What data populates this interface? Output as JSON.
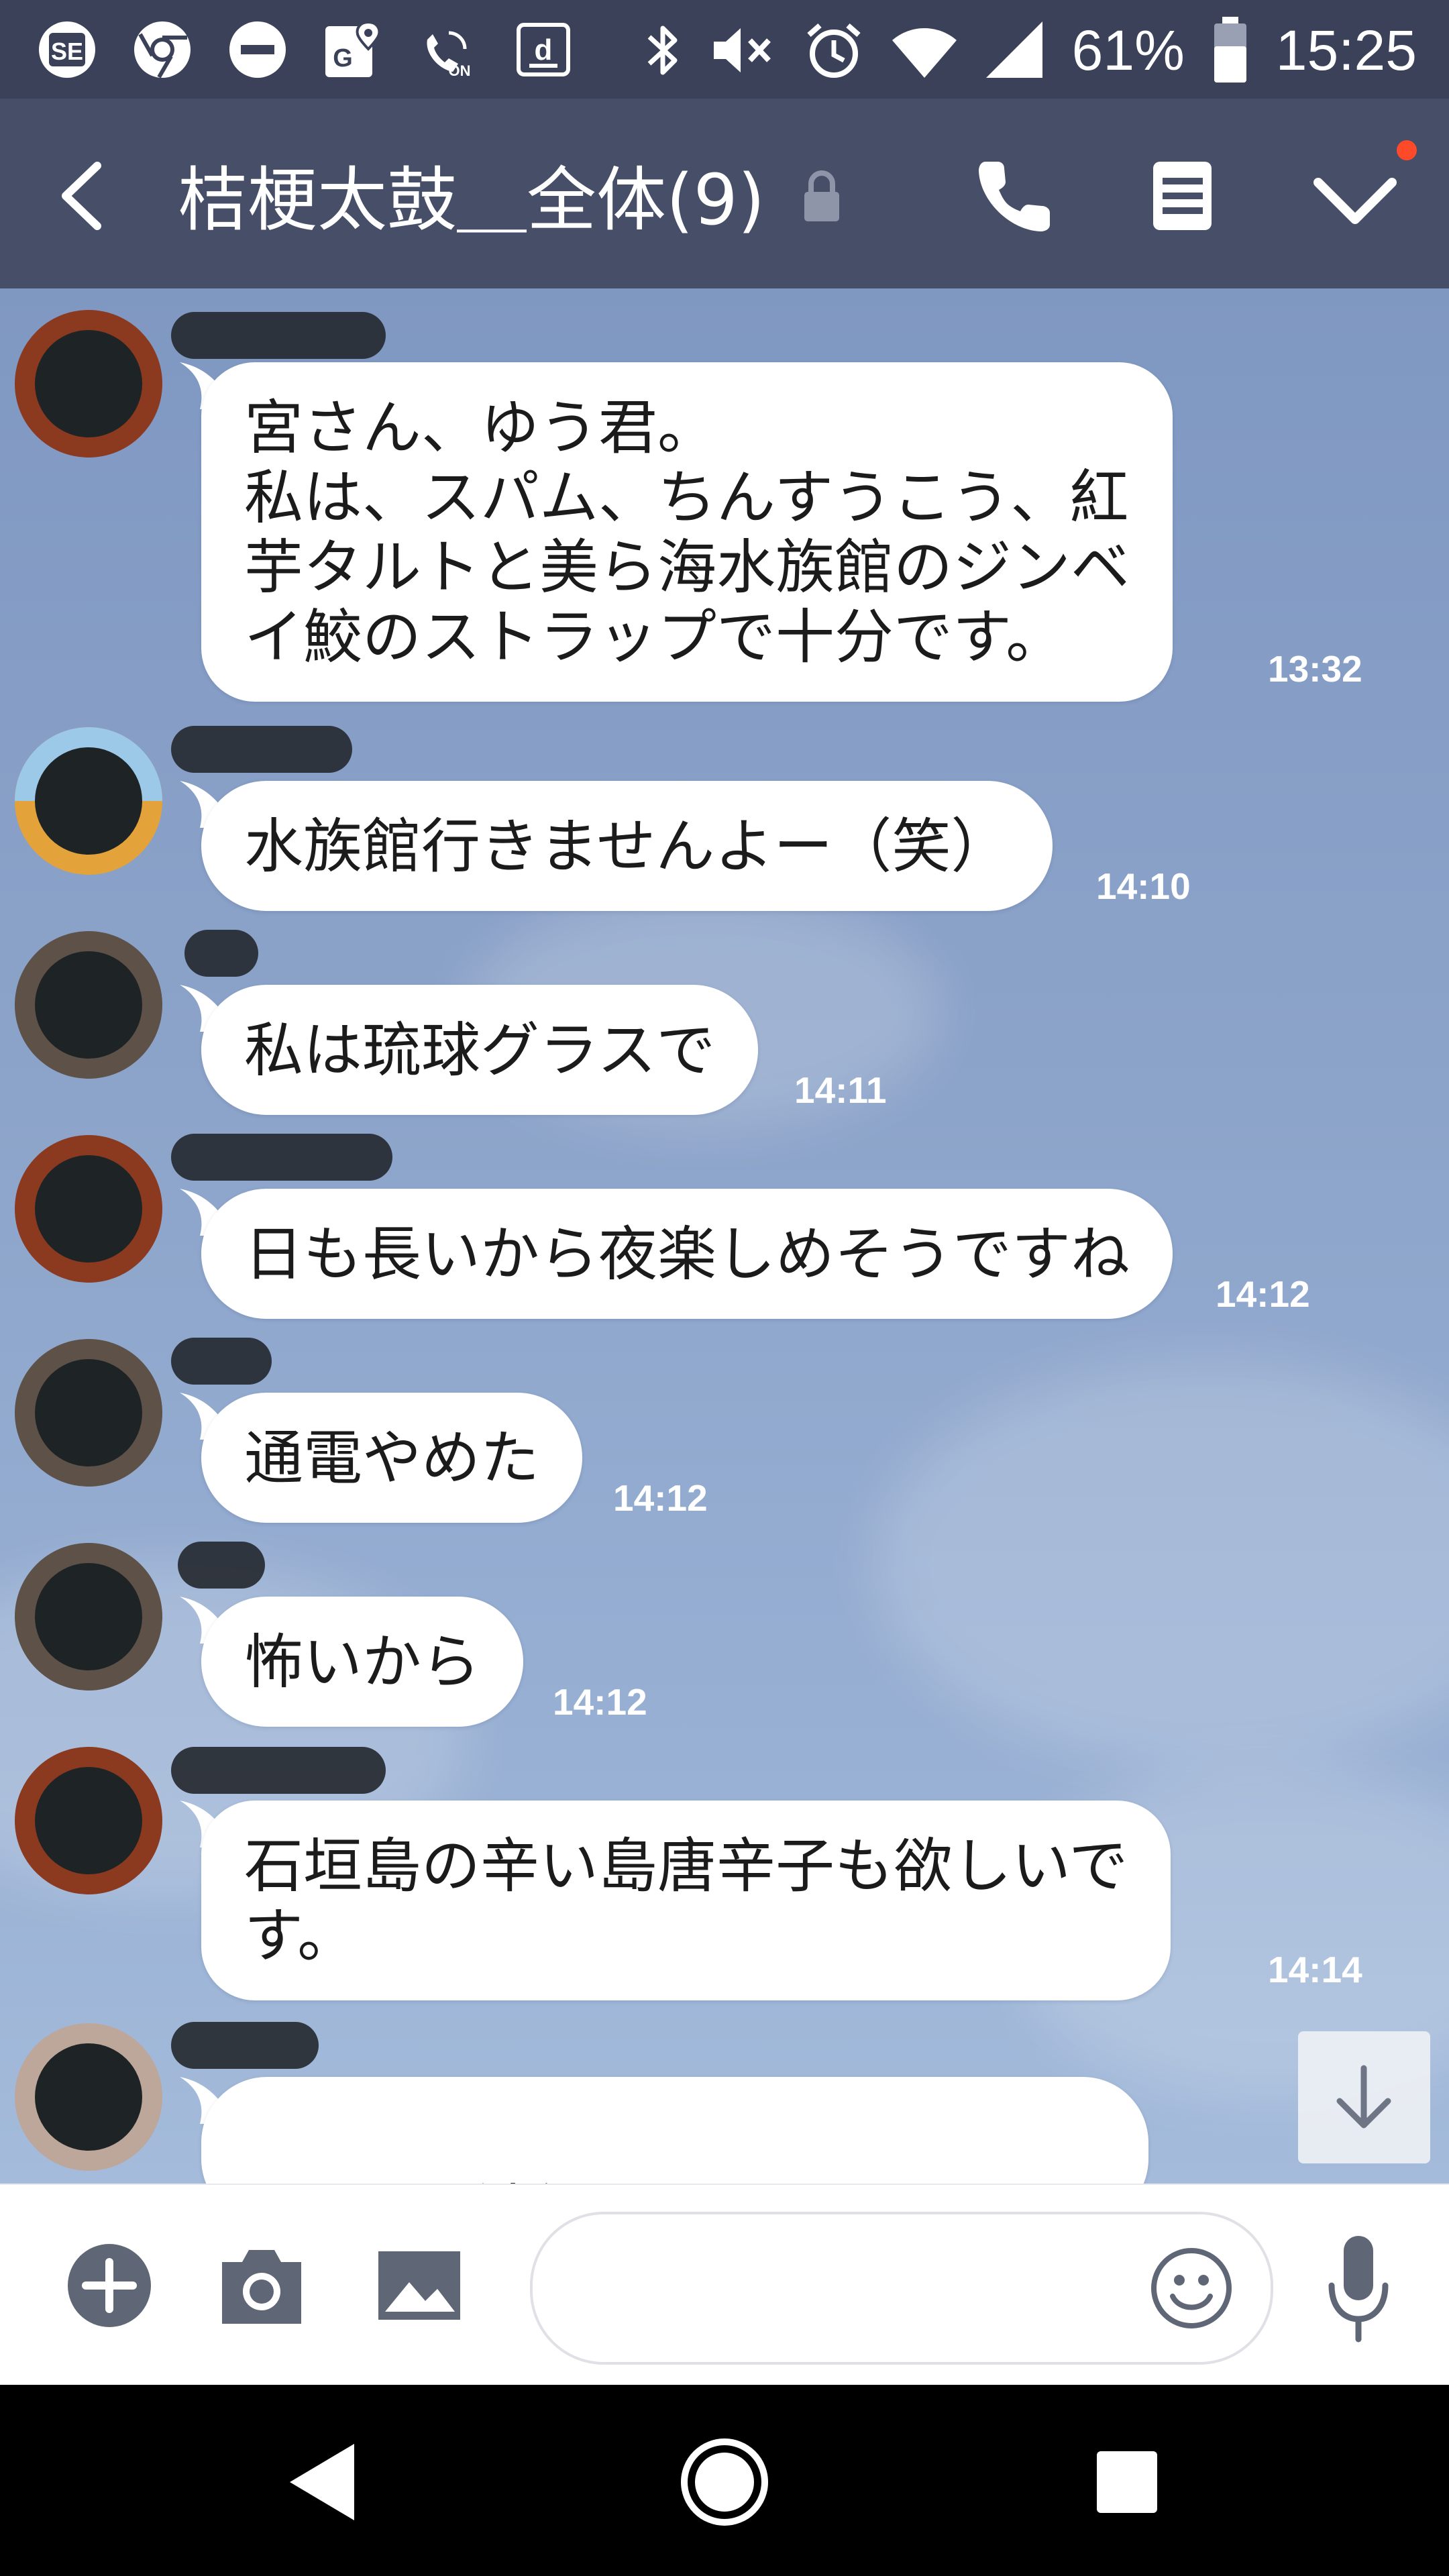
{
  "status_bar": {
    "battery_percent": "61%",
    "time": "15:25",
    "icons_left": [
      "se-app-icon",
      "chrome-icon",
      "do-not-disturb-icon",
      "maps-icon",
      "volte-icon",
      "docomo-icon"
    ],
    "icons_right": [
      "bluetooth-icon",
      "mute-icon",
      "alarm-icon",
      "wifi-icon",
      "signal-icon",
      "battery-icon"
    ]
  },
  "header": {
    "title": "桔梗太鼓＿全体(9)",
    "buttons": [
      "back",
      "call",
      "notes",
      "menu"
    ]
  },
  "messages": [
    {
      "text": "宮さん、ゆう君。\n私は、スパム、ちんすうこう、紅\n芋タルトと美ら海水族館のジンベ\nイ鮫のストラップで十分です。",
      "time": "13:32"
    },
    {
      "text": "水族館行きませんよー（笑）",
      "time": "14:10"
    },
    {
      "text": "私は琉球グラスで",
      "time": "14:11"
    },
    {
      "text": "日も長いから夜楽しめそうですね",
      "time": "14:12"
    },
    {
      "text": "通電やめた",
      "time": "14:12"
    },
    {
      "text": "怖いから",
      "time": "14:12"
    },
    {
      "text": "石垣島の辛い島唐辛子も欲しいで\nす。",
      "time": "14:14"
    },
    {
      "text": "え、沖縄ですか",
      "time": ""
    }
  ],
  "colors": {
    "status_bar": "#3a4158",
    "header": "#474e67",
    "chat_background": "#8ca3c9",
    "bubble": "#ffffff",
    "unread_dot": "#ff4a2a"
  },
  "input_bar": {
    "buttons": [
      "plus-icon",
      "camera-icon",
      "image-icon",
      "emoji-icon",
      "microphone-icon"
    ],
    "placeholder": ""
  }
}
